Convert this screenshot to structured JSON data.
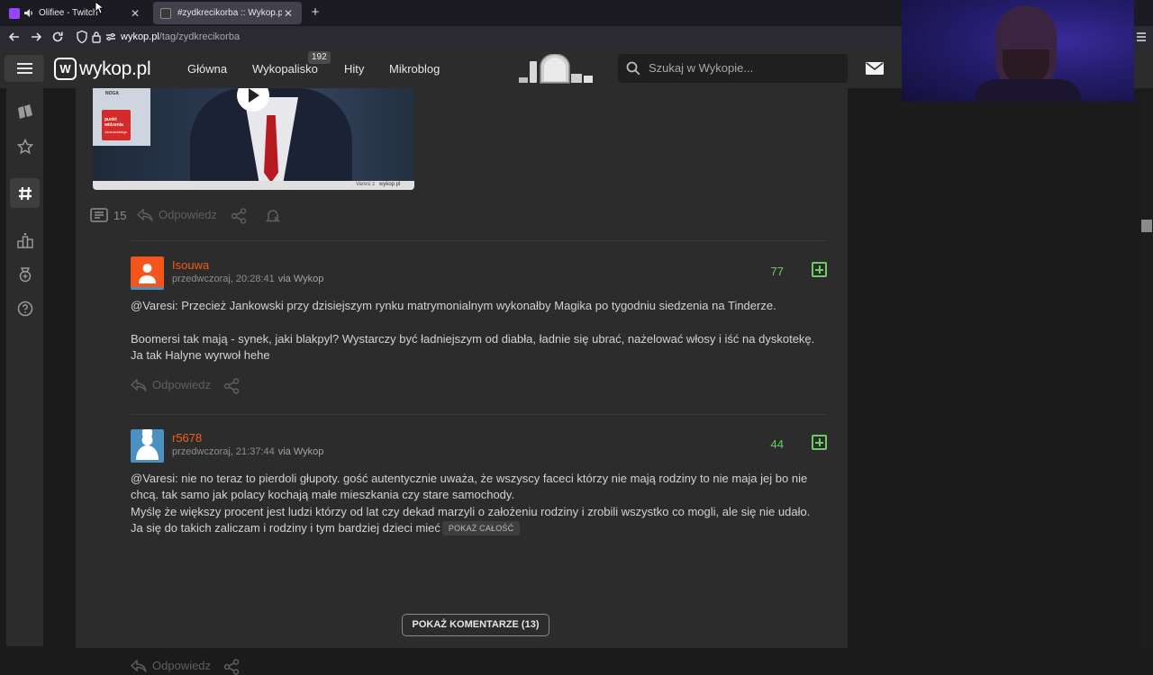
{
  "browser": {
    "tabs": [
      {
        "title": "Olifiee - Twitch",
        "close": "✕",
        "favicon_color": "#9146ff"
      },
      {
        "title": "#zydkrecikorba :: Wykop.pl",
        "close": "✕",
        "favicon_color": "#4caf50"
      }
    ],
    "new_tab": "+",
    "url_domain": "wykop.pl",
    "url_path": "/tag/zydkrecikorba"
  },
  "header": {
    "logo_text": "wykop.pl",
    "nav": [
      "Główna",
      "Wykopalisko",
      "Hity",
      "Mikroblog"
    ],
    "wykopalisko_badge": "192",
    "search_placeholder": "Szukaj w Wykopie..."
  },
  "post": {
    "video_watermark": "Varesi z",
    "video_caption_1": "punkt widzenia",
    "video_caption_2": "Jankowskiego",
    "video_tag": "NOGA",
    "comments_count": "15",
    "reply_label": "Odpowiedz"
  },
  "comments": [
    {
      "username": "Isouwa",
      "time": "przedwczoraj, 20:28:41",
      "via": "via Wykop",
      "votes": "77",
      "paragraphs": [
        "@Varesi: Przecież Jankowski przy dzisiejszym rynku matrymonialnym wykonałby Magika po tygodniu siedzenia na Tinderze.",
        "Boomersi tak mają - synek, jaki blakpyl? Wystarczy być ładniejszym od diabła, ładnie się ubrać, nażelować włosy i iść na dyskotekę. Ja tak Halyne wyrwoł hehe"
      ],
      "reply_label": "Odpowiedz",
      "avatar_color": "#f5541b"
    },
    {
      "username": "r5678",
      "time": "przedwczoraj, 21:37:44",
      "via": "via Wykop",
      "votes": "44",
      "paragraphs": [
        "@Varesi: nie no teraz to pierdoli głupoty. gość autentycznie uważa, że wszyscy faceci którzy nie mają rodziny to nie maja jej bo nie chcą. tak samo jak polacy kochają małe mieszkania czy stare samochody.",
        "Myślę że większy procent jest ludzi którzy od lat czy dekad marzyli o założeniu rodziny i zrobili wszystko co mogli, ale się nie udało.",
        "Ja się do takich zaliczam i rodziny i tym bardziej dzieci mieć"
      ],
      "show_all": "POKAŻ CAŁOŚĆ",
      "reply_label": "Odpowiedz",
      "avatar_color": "#4a90c2"
    }
  ],
  "show_comments_button": "POKAŻ KOMENTARZE (13)",
  "colors": {
    "accent_orange": "#f55b1b",
    "vote_green": "#6bcf62",
    "background": "#1b1b1c",
    "panel": "#2c2c2d"
  }
}
